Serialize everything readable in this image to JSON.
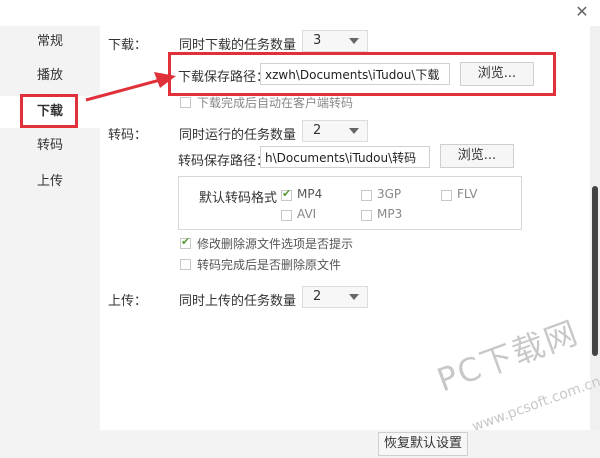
{
  "window": {
    "close_glyph": "✕"
  },
  "sidebar": {
    "items": [
      "常规",
      "播放",
      "下载",
      "转码",
      "上传"
    ],
    "active": "下载"
  },
  "download": {
    "section_label": "下载：",
    "tasks_label": "同时下载的任务数量",
    "tasks_value": "3",
    "path_label": "下载保存路径：",
    "path_value": "xzwh\\Documents\\iTudou\\下载",
    "browse_label": "浏览...",
    "auto_transcode_label": "下载完成后自动在客户端转码",
    "auto_transcode_checked": false
  },
  "transcode": {
    "section_label": "转码：",
    "tasks_label": "同时运行的任务数量",
    "tasks_value": "2",
    "path_label": "转码保存路径：",
    "path_value": "h\\Documents\\iTudou\\转码",
    "browse_label": "浏览...",
    "format_label": "默认转码格式",
    "formats": [
      {
        "name": "MP4",
        "checked": true
      },
      {
        "name": "3GP",
        "checked": false
      },
      {
        "name": "FLV",
        "checked": false
      },
      {
        "name": "AVI",
        "checked": false
      },
      {
        "name": "MP3",
        "checked": false
      }
    ],
    "prompt_label": "修改删除源文件选项是否提示",
    "prompt_checked": true,
    "delete_label": "转码完成后是否删除原文件",
    "delete_checked": false
  },
  "upload": {
    "section_label": "上传：",
    "tasks_label": "同时上传的任务数量",
    "tasks_value": "2"
  },
  "footer": {
    "restore_label": "恢复默认设置"
  },
  "watermark": {
    "line1": "PC下载网",
    "line2": "www.pcsoft.com.cn"
  },
  "colors": {
    "highlight": "#e0313b",
    "check": "#5b9a3a"
  }
}
